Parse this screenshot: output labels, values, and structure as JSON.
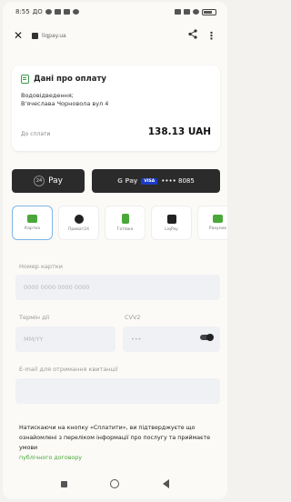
{
  "status_bar": {
    "time": "8:55",
    "extra": "ДО"
  },
  "browser": {
    "url": "liqpay.ua",
    "close_symbol": "✕",
    "share_symbol": "<",
    "more_symbol": "⋮"
  },
  "payment_card": {
    "title": "Дані про оплату",
    "service_line1": "Водовідведення;",
    "service_line2": "В'ячеслава Чорновола вул 4",
    "amount_label": "До сплати",
    "amount": "138.13 UAH"
  },
  "wallets": {
    "apple_pay": {
      "badge": "24",
      "label": "Pay"
    },
    "google_pay": {
      "label": "G Pay",
      "card_brand": "VISA",
      "card_number": "•••• 8085"
    }
  },
  "methods": [
    {
      "label": "Картка",
      "icon": "card-icon",
      "color": "#4aa83a"
    },
    {
      "label": "Приват24",
      "icon": "privat24-icon",
      "color": "#222222"
    },
    {
      "label": "Готівка",
      "icon": "cash-icon",
      "color": "#4aa83a"
    },
    {
      "label": "LiqPay",
      "icon": "liqpay-icon",
      "color": "#222222"
    },
    {
      "label": "Рахунок",
      "icon": "invoice-icon",
      "color": "#4aa83a"
    }
  ],
  "form": {
    "card_number_label": "Номер картки",
    "card_number_placeholder": "0000 0000 0000 0000",
    "expiry_label": "Термін дії",
    "expiry_placeholder": "MM/YY",
    "cvv_label": "CVV2",
    "cvv_placeholder": "•••",
    "email_label": "E-mail для отримання квитанції",
    "email_placeholder": ""
  },
  "terms": {
    "text": "Натискаючи на кнопку «Сплатити», ви підтверджуєте що ознайомлені з переліком інформації про послугу та приймаєте умови",
    "link": "публічного договору"
  },
  "colors": {
    "accent_green": "#4aa83a",
    "active_border": "#7fb6e6",
    "visa_blue": "#1a3cc8"
  }
}
